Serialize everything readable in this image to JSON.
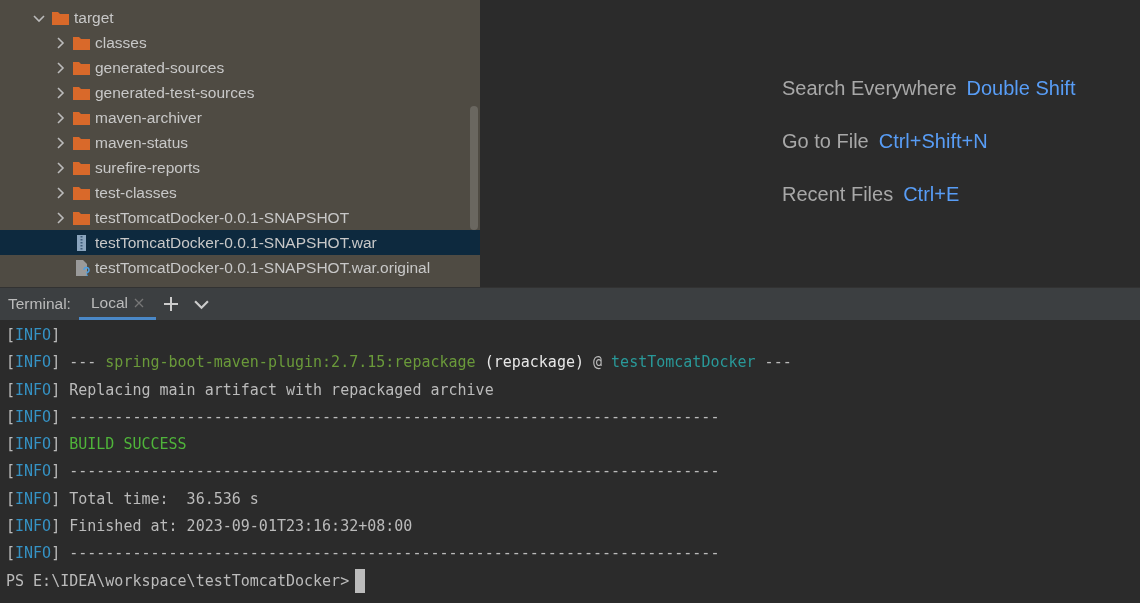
{
  "project_tree": {
    "items": [
      {
        "label": "target",
        "kind": "folder",
        "expanded": true,
        "selected": false,
        "children": [
          {
            "label": "classes",
            "kind": "folder",
            "expanded": false,
            "selected": false
          },
          {
            "label": "generated-sources",
            "kind": "folder",
            "expanded": false,
            "selected": false
          },
          {
            "label": "generated-test-sources",
            "kind": "folder",
            "expanded": false,
            "selected": false
          },
          {
            "label": "maven-archiver",
            "kind": "folder",
            "expanded": false,
            "selected": false
          },
          {
            "label": "maven-status",
            "kind": "folder",
            "expanded": false,
            "selected": false
          },
          {
            "label": "surefire-reports",
            "kind": "folder",
            "expanded": false,
            "selected": false
          },
          {
            "label": "test-classes",
            "kind": "folder",
            "expanded": false,
            "selected": false
          },
          {
            "label": "testTomcatDocker-0.0.1-SNAPSHOT",
            "kind": "folder",
            "expanded": false,
            "selected": false
          },
          {
            "label": "testTomcatDocker-0.0.1-SNAPSHOT.war",
            "kind": "archive",
            "selected": true
          },
          {
            "label": "testTomcatDocker-0.0.1-SNAPSHOT.war.original",
            "kind": "unknown",
            "selected": false
          }
        ]
      }
    ]
  },
  "editor_hints": [
    {
      "action": "Search Everywhere",
      "shortcut": "Double Shift"
    },
    {
      "action": "Go to File",
      "shortcut": "Ctrl+Shift+N"
    },
    {
      "action": "Recent Files",
      "shortcut": "Ctrl+E"
    }
  ],
  "terminal": {
    "label": "Terminal:",
    "tabs": [
      {
        "label": "Local",
        "selected": true
      }
    ],
    "lines": [
      {
        "segments": [
          {
            "text": "[",
            "kind": "plain"
          },
          {
            "text": "INFO",
            "kind": "level"
          },
          {
            "text": "]",
            "kind": "plain"
          }
        ]
      },
      {
        "segments": [
          {
            "text": "[",
            "kind": "plain"
          },
          {
            "text": "INFO",
            "kind": "level"
          },
          {
            "text": "] --- ",
            "kind": "plain"
          },
          {
            "text": "spring-boot-maven-plugin:2.7.15:repackage",
            "kind": "plugin"
          },
          {
            "text": " (repackage)",
            "kind": "goal"
          },
          {
            "text": " @ ",
            "kind": "plain"
          },
          {
            "text": "testTomcatDocker",
            "kind": "project"
          },
          {
            "text": " ---",
            "kind": "plain"
          }
        ]
      },
      {
        "segments": [
          {
            "text": "[",
            "kind": "plain"
          },
          {
            "text": "INFO",
            "kind": "level"
          },
          {
            "text": "] Replacing main artifact with repackaged archive",
            "kind": "plain"
          }
        ]
      },
      {
        "segments": [
          {
            "text": "[",
            "kind": "plain"
          },
          {
            "text": "INFO",
            "kind": "level"
          },
          {
            "text": "] ------------------------------------------------------------------------",
            "kind": "plain"
          }
        ]
      },
      {
        "segments": [
          {
            "text": "[",
            "kind": "plain"
          },
          {
            "text": "INFO",
            "kind": "level"
          },
          {
            "text": "] ",
            "kind": "plain"
          },
          {
            "text": "BUILD SUCCESS",
            "kind": "success"
          }
        ]
      },
      {
        "segments": [
          {
            "text": "[",
            "kind": "plain"
          },
          {
            "text": "INFO",
            "kind": "level"
          },
          {
            "text": "] ------------------------------------------------------------------------",
            "kind": "plain"
          }
        ]
      },
      {
        "segments": [
          {
            "text": "[",
            "kind": "plain"
          },
          {
            "text": "INFO",
            "kind": "level"
          },
          {
            "text": "] Total time:  36.536 s",
            "kind": "plain"
          }
        ]
      },
      {
        "segments": [
          {
            "text": "[",
            "kind": "plain"
          },
          {
            "text": "INFO",
            "kind": "level"
          },
          {
            "text": "] Finished at: 2023-09-01T23:16:32+08:00",
            "kind": "plain"
          }
        ]
      },
      {
        "segments": [
          {
            "text": "[",
            "kind": "plain"
          },
          {
            "text": "INFO",
            "kind": "level"
          },
          {
            "text": "] ------------------------------------------------------------------------",
            "kind": "plain"
          }
        ]
      }
    ],
    "prompt": "PS E:\\IDEA\\workspace\\testTomcatDocker>"
  }
}
